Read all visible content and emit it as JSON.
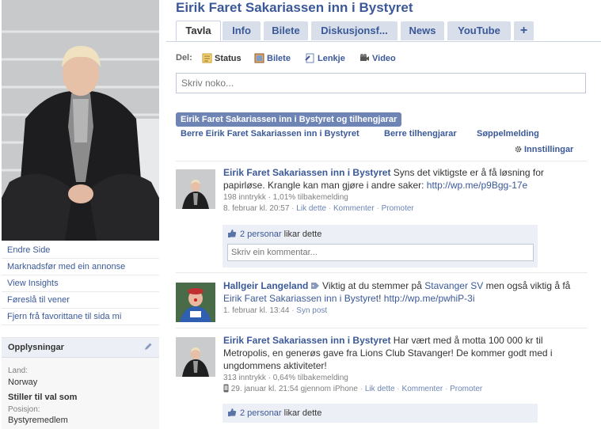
{
  "page": {
    "title": "Eirik Faret Sakariassen inn i Bystyret"
  },
  "tabs": [
    {
      "label": "Tavla"
    },
    {
      "label": "Info"
    },
    {
      "label": "Bilete"
    },
    {
      "label": "Diskusjonsf..."
    },
    {
      "label": "News"
    },
    {
      "label": "YouTube"
    },
    {
      "label": "+"
    }
  ],
  "left_links": [
    {
      "label": "Endre Side"
    },
    {
      "label": "Marknadsfør med ein annonse"
    },
    {
      "label": "View Insights"
    },
    {
      "label": "Føreslå til vener"
    },
    {
      "label": "Fjern frå favorittane til sida mi"
    }
  ],
  "info": {
    "title": "Opplysningar",
    "land_label": "Land:",
    "land_value": "Norway",
    "stiller_title": "Stiller til val som",
    "posisjon_label": "Posisjon:",
    "posisjon_value": "Bystyremedlem"
  },
  "share": {
    "label": "Del:",
    "status": "Status",
    "photo": "Bilete",
    "link": "Lenkje",
    "video": "Video",
    "placeholder": "Skriv noko..."
  },
  "filters": {
    "active": "Eirik Faret Sakariassen inn i Bystyret og tilhengjarar",
    "only_page": "Berre Eirik Faret Sakariassen inn i Bystyret",
    "only_fans": "Berre tilhengjarar",
    "spam": "Søppelmelding",
    "settings": "Innstillingar"
  },
  "posts": [
    {
      "author": "Eirik Faret Sakariassen inn i Bystyret",
      "text": "Syns det viktigste er å få løsning for papirløse. Krangle kan man gjøre i andre saker:",
      "link": "http://wp.me/p9Bgg-17e",
      "stats": "198 inntrykk · 1,01% tilbakemelding",
      "time": "8. februar kl. 20:57",
      "actions": [
        "Lik dette",
        "Kommenter",
        "Promoter"
      ],
      "likes_count": "2 personar",
      "likes_suffix": "likar dette",
      "comment_placeholder": "Skriv ein kommentar..."
    },
    {
      "author": "Hallgeir Langeland",
      "text_pre": "Viktig at du stemmer på",
      "mention1": "Stavanger SV",
      "text_mid": "men også viktig å få",
      "mention2": "Eirik Faret Sakariassen inn i Bystyret",
      "text_post": "!",
      "link": "http://wp.me/pwhiP-3i",
      "time": "1. februar kl. 13:44",
      "actions": [
        "Syn post"
      ]
    },
    {
      "author": "Eirik Faret Sakariassen inn i Bystyret",
      "text": "Har vært med å motta 100 000 kr til Metropolis, en generøs gave fra Lions Club Stavanger! De kommer godt med i ungdommens aktiviteter!",
      "stats": "313 inntrykk · 0,64% tilbakemelding",
      "time": "29. januar kl. 21:54 gjennom iPhone",
      "actions": [
        "Lik dette",
        "Kommenter",
        "Promoter"
      ],
      "likes_count": "2 personar",
      "likes_suffix": "likar dette"
    }
  ],
  "colors": {
    "brand_blue": "#3b5998",
    "tab_bg": "#d8dfea",
    "filter_active_bg": "#6d84b4",
    "like_box_bg": "#eceff5"
  },
  "icons": [
    "status-icon",
    "photo-icon",
    "link-icon",
    "video-icon",
    "gear-icon",
    "pencil-icon",
    "thumbs-up-icon",
    "iphone-icon",
    "tag-icon"
  ]
}
